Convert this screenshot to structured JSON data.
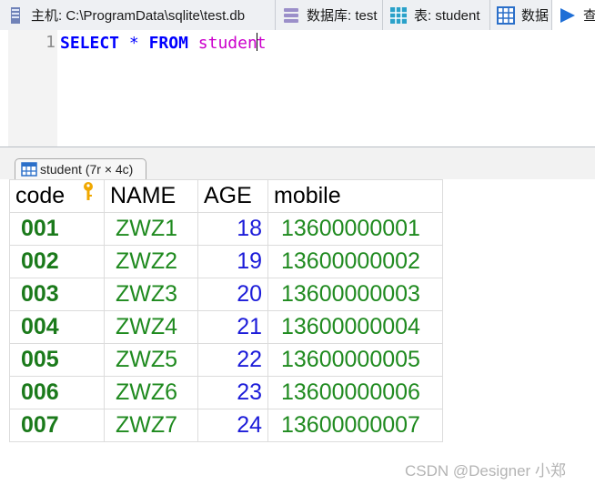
{
  "tabs": [
    {
      "label": "主机: C:\\ProgramData\\sqlite\\test.db",
      "icon": "database-server-icon"
    },
    {
      "label": "数据库: test",
      "icon": "database-icon"
    },
    {
      "label": "表: student",
      "icon": "table-icon"
    },
    {
      "label": "数据",
      "icon": "grid-data-icon"
    },
    {
      "label": "查",
      "icon": "play-query-icon"
    }
  ],
  "editor": {
    "line_number": "1",
    "kw_select": "SELECT",
    "star": "*",
    "kw_from": "FROM",
    "table_before_caret": "studen",
    "table_after_caret": "t"
  },
  "result": {
    "tab_label": "student (7r × 4c)",
    "columns": [
      "code",
      "NAME",
      "AGE",
      "mobile"
    ],
    "rows": [
      [
        "001",
        "ZWZ1",
        "18",
        "13600000001"
      ],
      [
        "002",
        "ZWZ2",
        "19",
        "13600000002"
      ],
      [
        "003",
        "ZWZ3",
        "20",
        "13600000003"
      ],
      [
        "004",
        "ZWZ4",
        "21",
        "13600000004"
      ],
      [
        "005",
        "ZWZ5",
        "22",
        "13600000005"
      ],
      [
        "006",
        "ZWZ6",
        "23",
        "13600000006"
      ],
      [
        "007",
        "ZWZ7",
        "24",
        "13600000007"
      ]
    ]
  },
  "watermark": "CSDN @Designer 小郑",
  "colors": {
    "keyword": "#0000ff",
    "table_name": "#cc00cc",
    "cell_text": "#1f8a1f",
    "age_text": "#1c1cd9",
    "key_icon": "#f0a800"
  }
}
